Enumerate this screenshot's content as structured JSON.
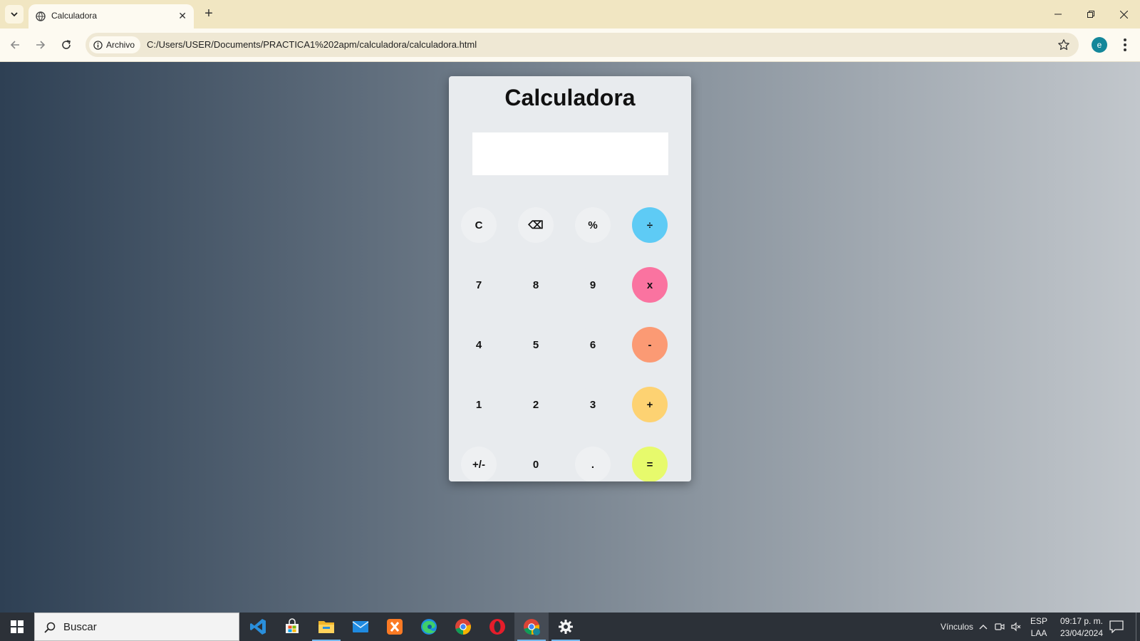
{
  "browser": {
    "tab_title": "Calculadora",
    "chip_label": "Archivo",
    "url": "C:/Users/USER/Documents/PRACTICA1%202apm/calculadora/calculadora.html",
    "profile_initial": "e"
  },
  "calculator": {
    "title": "Calculadora",
    "display_value": "",
    "keys": [
      {
        "label": "C",
        "color": "#eef0f2"
      },
      {
        "label": "⌫",
        "color": "#eef0f2"
      },
      {
        "label": "%",
        "color": "#eef0f2"
      },
      {
        "label": "÷",
        "color": "#5ecbf5"
      },
      {
        "label": "7",
        "color": "#e8ebee"
      },
      {
        "label": "8",
        "color": "#e8ebee"
      },
      {
        "label": "9",
        "color": "#e8ebee"
      },
      {
        "label": "x",
        "color": "#fa73a0"
      },
      {
        "label": "4",
        "color": "#e8ebee"
      },
      {
        "label": "5",
        "color": "#e8ebee"
      },
      {
        "label": "6",
        "color": "#e8ebee"
      },
      {
        "label": "-",
        "color": "#fb9a74"
      },
      {
        "label": "1",
        "color": "#e8ebee"
      },
      {
        "label": "2",
        "color": "#e8ebee"
      },
      {
        "label": "3",
        "color": "#e8ebee"
      },
      {
        "label": "+",
        "color": "#fdd272"
      },
      {
        "label": "+/-",
        "color": "#eef0f2"
      },
      {
        "label": "0",
        "color": "#e8ebee"
      },
      {
        "label": ".",
        "color": "#eef0f2"
      },
      {
        "label": "=",
        "color": "#e7fa6c"
      }
    ]
  },
  "taskbar": {
    "search_placeholder": "Buscar",
    "links_label": "Vínculos",
    "lang_line1": "ESP",
    "lang_line2": "LAA",
    "time": "09:17 p. m.",
    "date": "23/04/2024",
    "apps": [
      "vscode-icon",
      "store-icon",
      "file-explorer-icon",
      "mail-icon",
      "xampp-icon",
      "edge-icon",
      "chrome-icon",
      "opera-icon",
      "chrome-profile-icon",
      "settings-icon"
    ]
  }
}
